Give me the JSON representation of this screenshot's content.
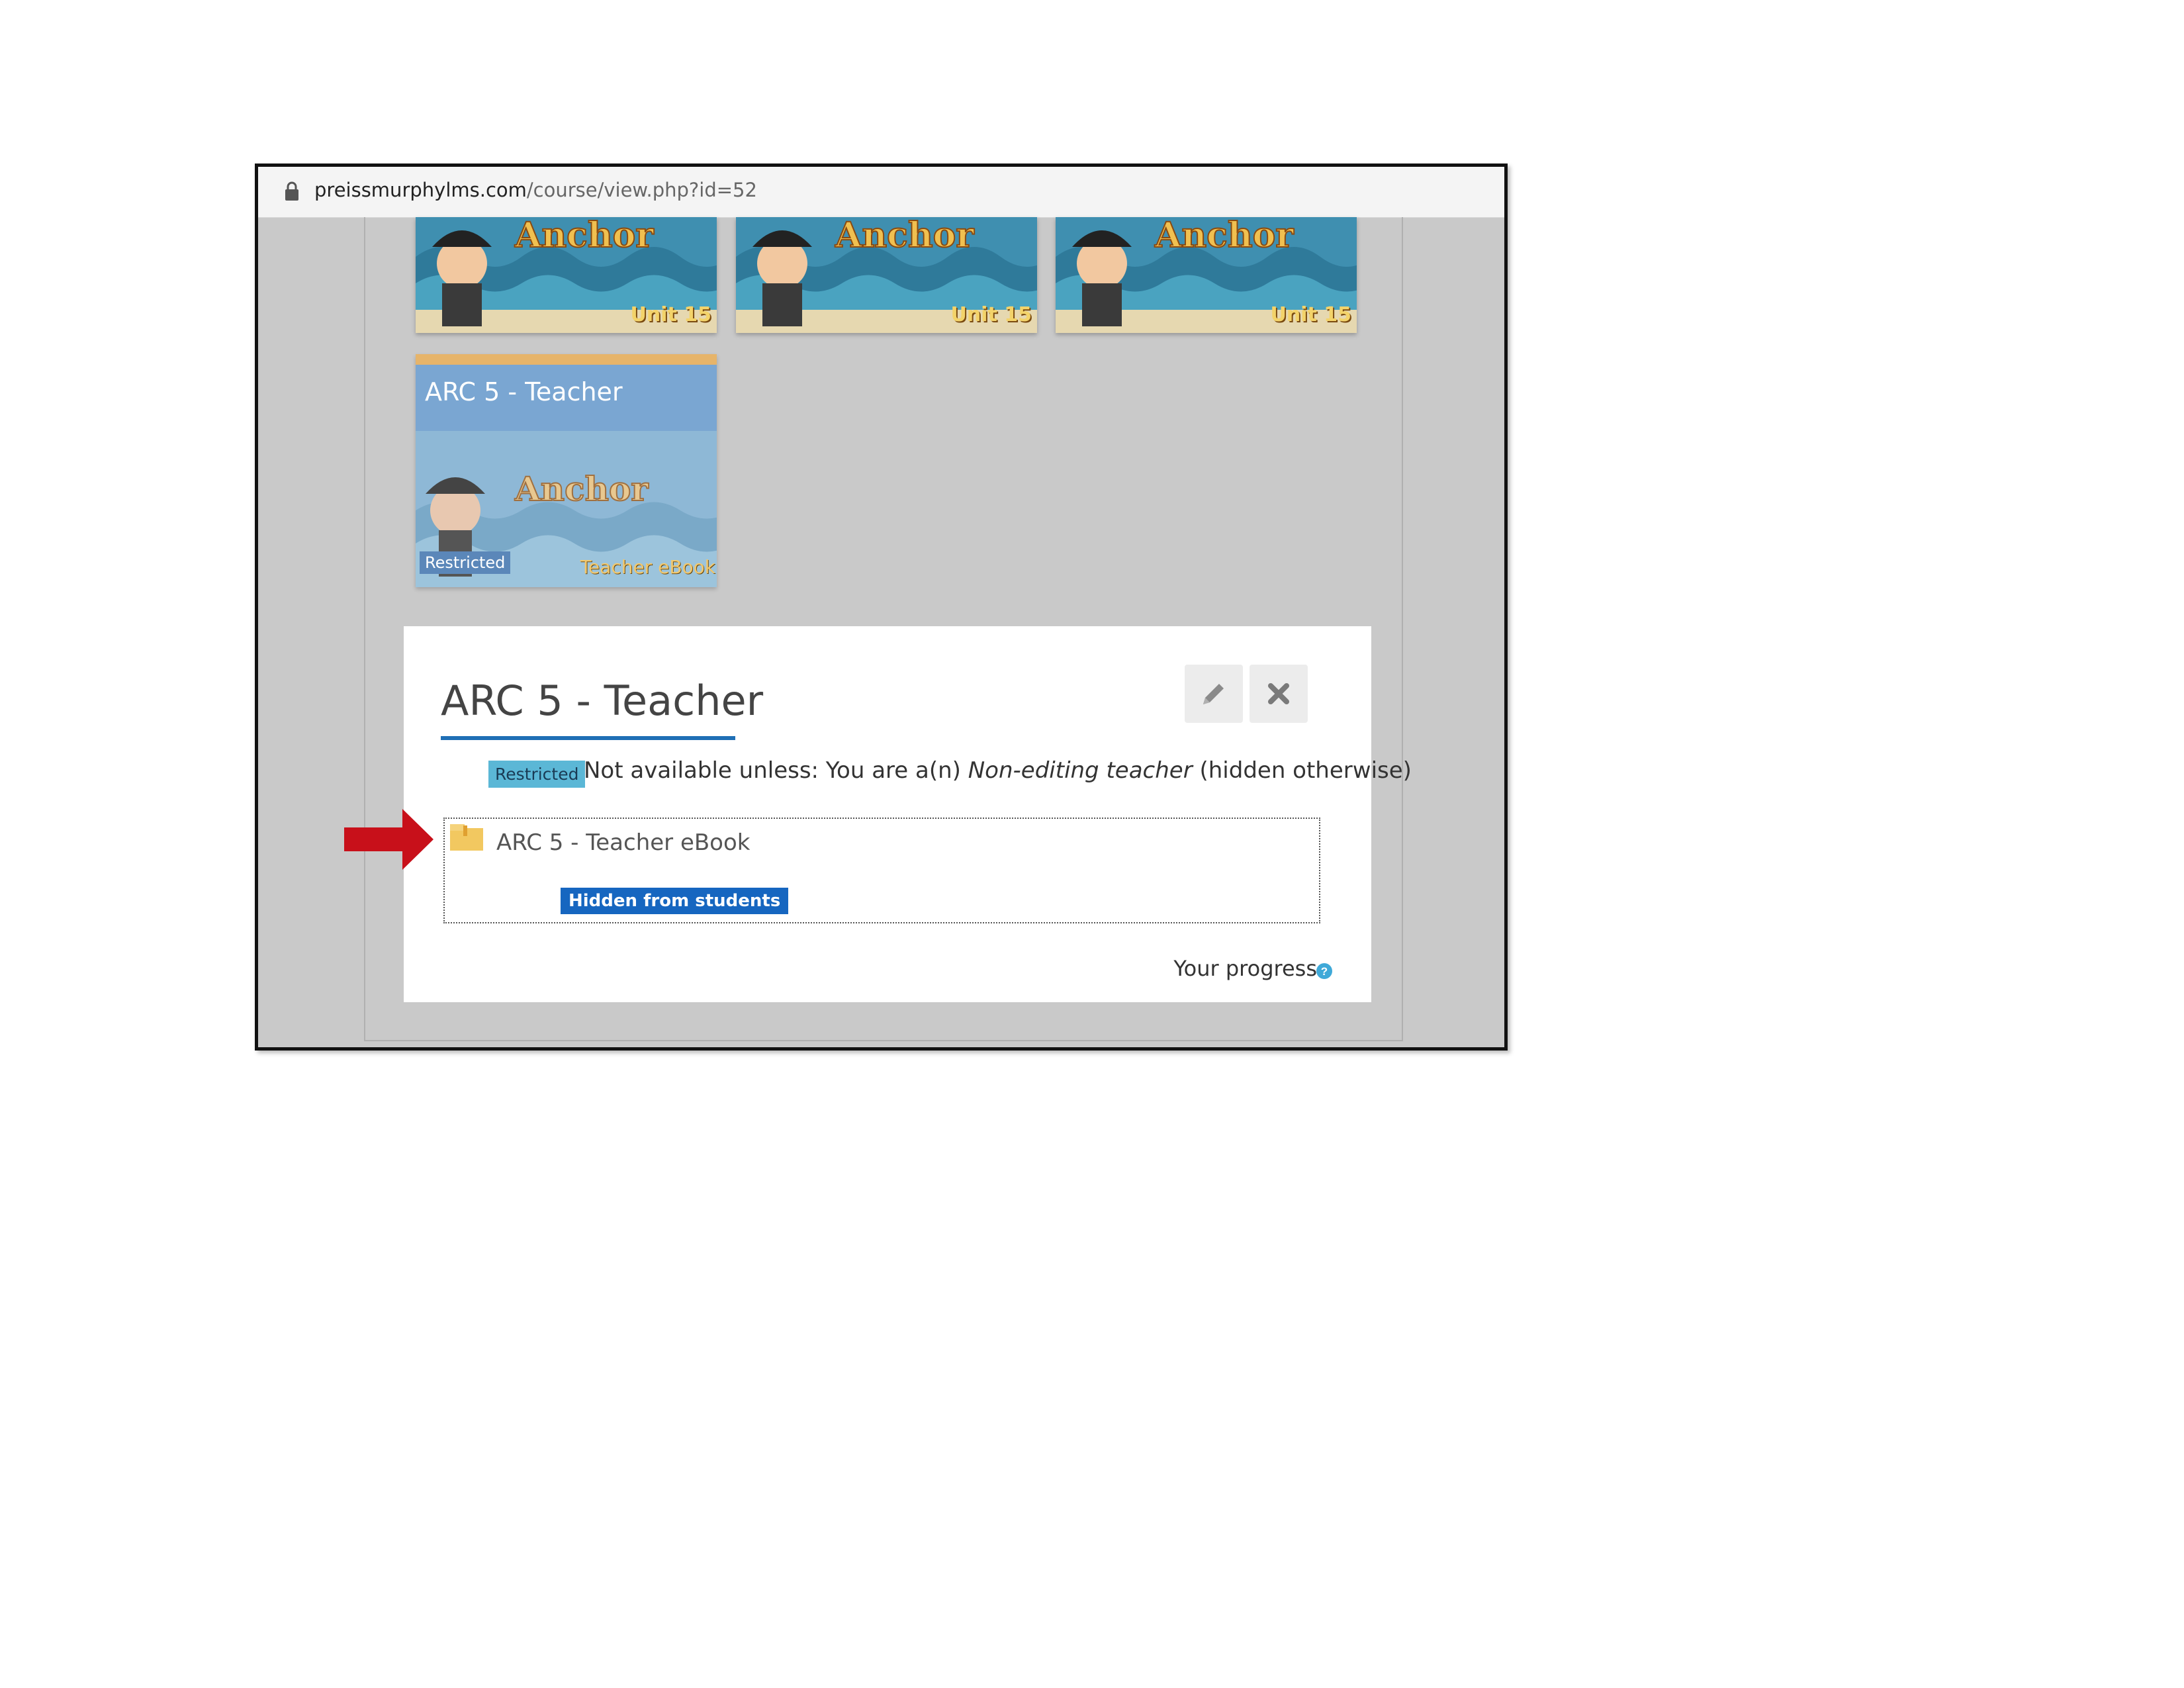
{
  "browser": {
    "url_domain": "preissmurphylms.com",
    "url_path": "/course/view.php?id=52"
  },
  "tiles": [
    {
      "label": "Unit 15"
    },
    {
      "label": "Unit 15"
    },
    {
      "label": "Unit 15"
    }
  ],
  "course_tile": {
    "title": "ARC 5 - Teacher",
    "restricted_label": "Restricted",
    "ebook_label": "Teacher eBook"
  },
  "section": {
    "title": "ARC 5 - Teacher",
    "restricted_badge": "Restricted",
    "availability_prefix": "Not available unless: You are a(n) ",
    "availability_role": "Non-editing teacher",
    "availability_suffix": " (hidden otherwise)",
    "activity_name": "ARC 5 - Teacher eBook",
    "hidden_badge": "Hidden from students",
    "progress_label": "Your progress"
  },
  "icons": [
    "lock-icon",
    "edit-pencil-icon",
    "close-x-icon",
    "folder-icon",
    "help-icon",
    "red-arrow-annotation"
  ],
  "colors": {
    "accent_blue": "#1f6fb5",
    "hidden_badge": "#1666c0",
    "restricted_badge": "#5bb7d6",
    "arrow": "#c8101a"
  }
}
